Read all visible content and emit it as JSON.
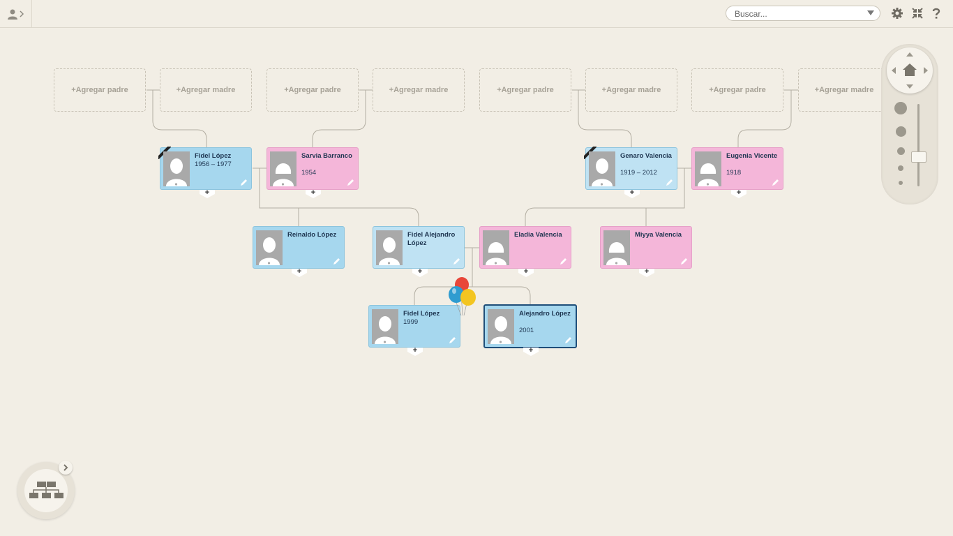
{
  "topbar": {
    "search_placeholder": "Buscar..."
  },
  "empty_slots": {
    "add_father": "+Agregar padre",
    "add_mother": "+Agregar madre"
  },
  "people": {
    "fidel_lopez_sr": {
      "name": "Fidel López",
      "dates": "1956 – 1977"
    },
    "sarvia_barranco": {
      "name": "Sarvia Barranco",
      "dates": "1954"
    },
    "genaro_valencia": {
      "name": "Genaro Valencia",
      "dates": "1919 – 2012"
    },
    "eugenia_vicente": {
      "name": "Eugenia Vicente",
      "dates": "1918"
    },
    "reinaldo_lopez": {
      "name": "Reinaldo López",
      "dates": ""
    },
    "fidel_alejandro_lopez": {
      "name": "Fidel Alejandro López",
      "dates": ""
    },
    "eladia_valencia": {
      "name": "Eladia Valencia",
      "dates": ""
    },
    "miyya_valencia": {
      "name": "Miyya Valencia",
      "dates": ""
    },
    "fidel_lopez_jr": {
      "name": "Fidel López",
      "dates": "1999"
    },
    "alejandro_lopez": {
      "name": "Alejandro López",
      "dates": "2001"
    }
  },
  "plus_symbol": "+",
  "colors": {
    "male_card": "#a6d7ee",
    "female_card": "#f4b6d9",
    "selected_border": "#1f4e79",
    "background": "#f2eee5"
  }
}
